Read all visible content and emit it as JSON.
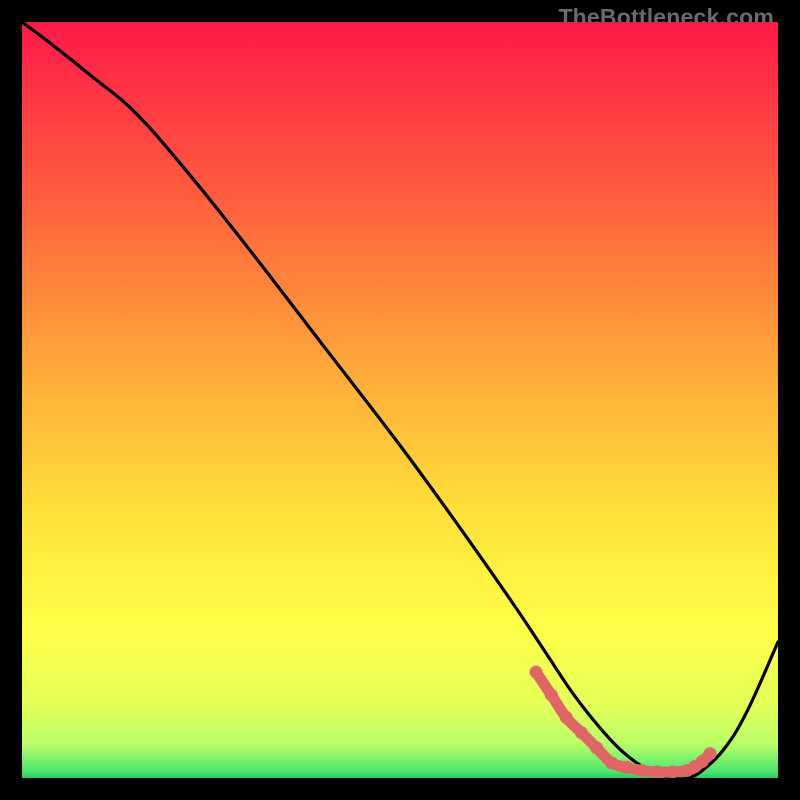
{
  "watermark": "TheBottleneck.com",
  "chart_data": {
    "type": "line",
    "title": "",
    "xlabel": "",
    "ylabel": "",
    "xlim": [
      0,
      100
    ],
    "ylim": [
      0,
      100
    ],
    "grid": false,
    "legend": false,
    "background_gradient": {
      "stops": [
        {
          "offset": 0.0,
          "color": "#ff1a49"
        },
        {
          "offset": 0.22,
          "color": "#ff5a3e"
        },
        {
          "offset": 0.45,
          "color": "#ffa63a"
        },
        {
          "offset": 0.65,
          "color": "#ffe13a"
        },
        {
          "offset": 0.8,
          "color": "#feff47"
        },
        {
          "offset": 0.9,
          "color": "#e7ff58"
        },
        {
          "offset": 0.955,
          "color": "#b9ff68"
        },
        {
          "offset": 0.99,
          "color": "#52e66e"
        },
        {
          "offset": 1.0,
          "color": "#29ce62"
        }
      ]
    },
    "series": [
      {
        "name": "bottleneck-curve",
        "color": "#000000",
        "x": [
          0,
          4,
          9,
          15,
          22,
          30,
          40,
          50,
          58,
          65,
          69,
          73,
          77,
          80,
          83,
          86,
          88,
          90,
          93,
          96,
          100
        ],
        "values": [
          100,
          97,
          93,
          88,
          80,
          70,
          57,
          44,
          33,
          23,
          17,
          11,
          6,
          3,
          1,
          0,
          0,
          1,
          4,
          9,
          18
        ]
      }
    ],
    "highlight": {
      "name": "optimal-range",
      "color": "#e06666",
      "points_x": [
        68,
        70,
        72,
        74,
        76,
        78,
        80,
        82,
        84,
        86,
        88,
        89,
        90,
        91
      ],
      "points_y": [
        14,
        11,
        8,
        6,
        4,
        2,
        1.4,
        1,
        0.8,
        0.8,
        1,
        1.5,
        2.2,
        3.2
      ]
    }
  }
}
